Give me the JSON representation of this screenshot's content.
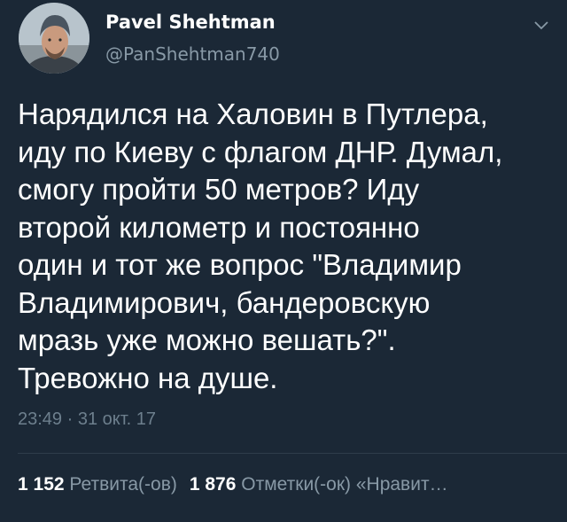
{
  "author": {
    "display_name": "Pavel Shehtman",
    "handle": "@PanShehtman740",
    "avatar_icon": "user-photo-avatar"
  },
  "menu": {
    "icon": "chevron-down-icon"
  },
  "tweet": {
    "lines": [
      "Нарядился на Халовин в Путлера,",
      "иду по Киеву с флагом ДНР. Думал,",
      "смогу пройти 50 метров? Иду",
      "второй километр и постоянно",
      "один и тот же вопрос \"Владимир",
      "Владимирович, бандеровскую",
      "мразь уже можно вешать?\".",
      "Тревожно на душе."
    ],
    "timestamp": "23:49 · 31 окт. 17"
  },
  "stats": {
    "retweets_count": "1 152",
    "retweets_label": "Ретвита(-ов)",
    "likes_count": "1 876",
    "likes_label": "Отметки(-ок) «Нравит…"
  },
  "colors": {
    "background": "#1b2836",
    "primary_text": "#ffffff",
    "secondary_text": "#8899a6"
  }
}
